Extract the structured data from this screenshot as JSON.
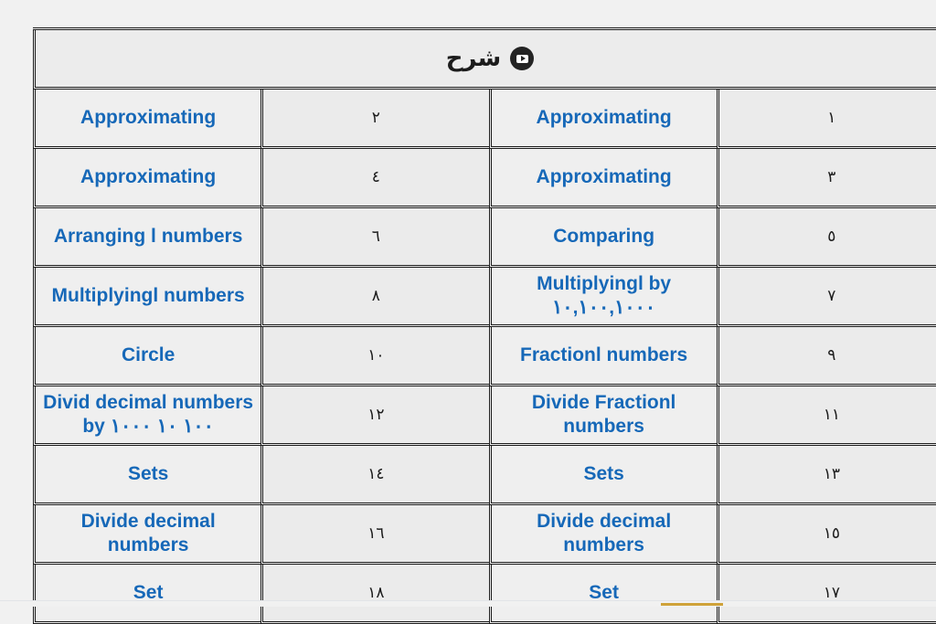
{
  "header": {
    "title": "شرح",
    "icon": "youtube-play-icon"
  },
  "colors": {
    "link_blue": "#1668b8",
    "border": "#1c1c1c",
    "cell_bg": "#efefef",
    "num_cell_bg": "#ebebeb",
    "page_bg": "#f1f1f1"
  },
  "table": {
    "rows": [
      {
        "left_title": "Approximating",
        "left_num": "٢",
        "right_title": "Approximating",
        "right_num": "١"
      },
      {
        "left_title": "Approximating",
        "left_num": "٤",
        "right_title": "Approximating",
        "right_num": "٣"
      },
      {
        "left_title": "Arranging l numbers",
        "left_num": "٦",
        "right_title": "Comparing",
        "right_num": "٥"
      },
      {
        "left_title": "Multiplyingl numbers",
        "left_num": "٨",
        "right_title": "Multiplyingl by ١٠,١٠٠,١٠٠٠",
        "right_num": "٧"
      },
      {
        "left_title": "Circle",
        "left_num": "١٠",
        "right_title": "Fractionl numbers",
        "right_num": "٩"
      },
      {
        "left_title": "Divid decimal numbers by  ١٠٠ ١٠ ١٠٠٠",
        "left_num": "١٢",
        "right_title": "Divide Fractionl numbers",
        "right_num": "١١"
      },
      {
        "left_title": "Sets",
        "left_num": "١٤",
        "right_title": "Sets",
        "right_num": "١٣"
      },
      {
        "left_title": "Divide decimal numbers",
        "left_num": "١٦",
        "right_title": "Divide decimal numbers",
        "right_num": "١٥"
      },
      {
        "left_title": "Set",
        "left_num": "١٨",
        "right_title": "Set",
        "right_num": "١٧"
      }
    ]
  }
}
